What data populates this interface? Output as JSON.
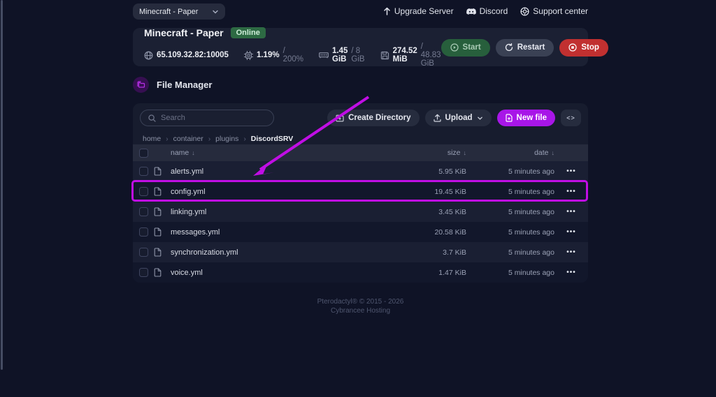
{
  "colors": {
    "accent_purple": "#a816e8",
    "annotation_magenta": "#c00ee4",
    "online_green": "#2d6a43",
    "stop_red": "#c13030"
  },
  "top_bar": {
    "server_selector": "Minecraft - Paper",
    "links": [
      {
        "icon": "arrow-up-icon",
        "label": "Upgrade Server"
      },
      {
        "icon": "discord-icon",
        "label": "Discord"
      },
      {
        "icon": "support-icon",
        "label": "Support center"
      }
    ]
  },
  "server_card": {
    "title": "Minecraft - Paper",
    "status": "Online",
    "stats": [
      {
        "icon": "globe-icon",
        "value": "65.109.32.82:10005",
        "secondary": ""
      },
      {
        "icon": "cpu-icon",
        "value": "1.19%",
        "secondary": "/ 200%"
      },
      {
        "icon": "memory-icon",
        "value": "1.45 GiB",
        "secondary": "/ 8 GiB"
      },
      {
        "icon": "disk-icon",
        "value": "274.52 MiB",
        "secondary": "/ 48.83 GiB"
      }
    ],
    "actions": {
      "start": "Start",
      "restart": "Restart",
      "stop": "Stop"
    }
  },
  "page": {
    "title": "File Manager"
  },
  "toolbar": {
    "search_placeholder": "Search",
    "create_directory": "Create Directory",
    "upload": "Upload",
    "new_file": "New file",
    "code_glyph": "<>"
  },
  "breadcrumb": [
    "home",
    "container",
    "plugins",
    "DiscordSRV"
  ],
  "file_table": {
    "columns": [
      "name",
      "size",
      "date"
    ],
    "sort_indicator": "↓",
    "row_menu_glyph": "•••",
    "rows": [
      {
        "name": "alerts.yml",
        "size": "5.95 KiB",
        "date": "5 minutes ago",
        "highlighted": false
      },
      {
        "name": "config.yml",
        "size": "19.45 KiB",
        "date": "5 minutes ago",
        "highlighted": true
      },
      {
        "name": "linking.yml",
        "size": "3.45 KiB",
        "date": "5 minutes ago",
        "highlighted": false
      },
      {
        "name": "messages.yml",
        "size": "20.58 KiB",
        "date": "5 minutes ago",
        "highlighted": false
      },
      {
        "name": "synchronization.yml",
        "size": "3.7 KiB",
        "date": "5 minutes ago",
        "highlighted": false
      },
      {
        "name": "voice.yml",
        "size": "1.47 KiB",
        "date": "5 minutes ago",
        "highlighted": false
      }
    ]
  },
  "footer": {
    "line1": "Pterodactyl® © 2015 - 2026",
    "line2": "Cybrancee Hosting"
  }
}
